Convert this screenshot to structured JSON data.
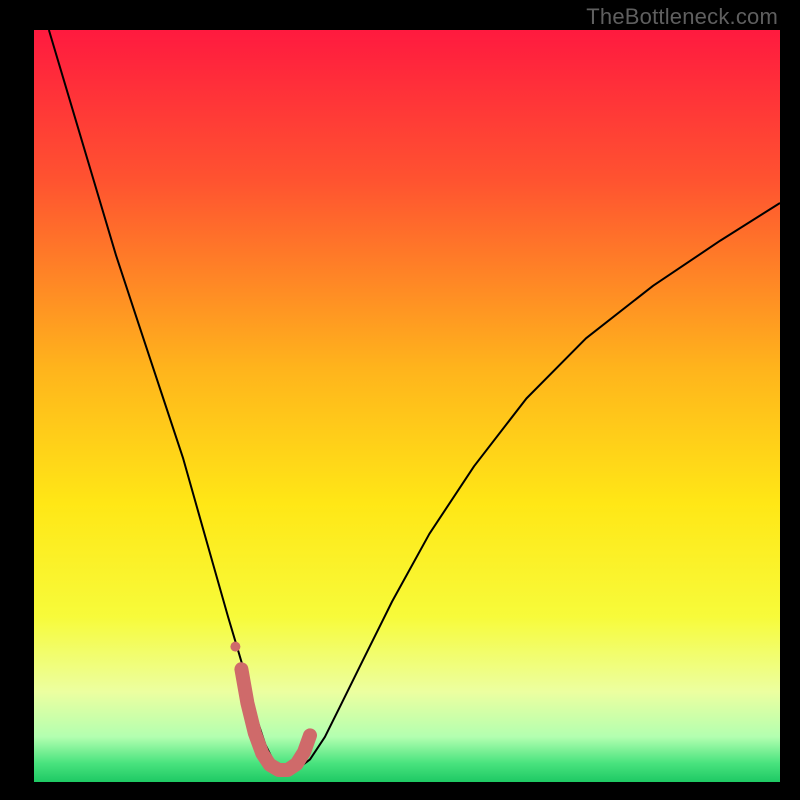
{
  "watermark": "TheBottleneck.com",
  "chart_data": {
    "type": "line",
    "title": "",
    "xlabel": "",
    "ylabel": "",
    "xlim": [
      0,
      100
    ],
    "ylim": [
      0,
      100
    ],
    "grid": false,
    "legend": false,
    "annotations": [],
    "background_gradient_stops": [
      {
        "offset": 0.0,
        "color": "#ff1a3f"
      },
      {
        "offset": 0.2,
        "color": "#ff5330"
      },
      {
        "offset": 0.45,
        "color": "#ffb41c"
      },
      {
        "offset": 0.63,
        "color": "#ffe716"
      },
      {
        "offset": 0.78,
        "color": "#f7fb3a"
      },
      {
        "offset": 0.88,
        "color": "#ecffa0"
      },
      {
        "offset": 0.94,
        "color": "#b3ffb0"
      },
      {
        "offset": 0.975,
        "color": "#49e37e"
      },
      {
        "offset": 1.0,
        "color": "#1ec964"
      }
    ],
    "series": [
      {
        "name": "bottleneck-curve",
        "stroke": "#000000",
        "stroke_width": 2,
        "x": [
          2,
          5,
          8,
          11,
          14,
          17,
          20,
          22,
          24,
          26,
          27.5,
          29,
          30,
          31,
          32,
          33.5,
          35,
          37,
          39,
          41,
          44,
          48,
          53,
          59,
          66,
          74,
          83,
          92,
          100
        ],
        "y": [
          100,
          90,
          80,
          70,
          61,
          52,
          43,
          36,
          29,
          22,
          17,
          12,
          8,
          5,
          3,
          1.5,
          1.5,
          3,
          6,
          10,
          16,
          24,
          33,
          42,
          51,
          59,
          66,
          72,
          77
        ]
      },
      {
        "name": "highlight-band",
        "stroke": "#cf6a6a",
        "stroke_width": 14,
        "linecap": "round",
        "x": [
          27.8,
          28.6,
          29.6,
          30.6,
          31.6,
          32.8,
          34.0,
          35.2,
          36.2,
          37.0
        ],
        "y": [
          15.0,
          10.5,
          6.5,
          3.8,
          2.3,
          1.6,
          1.6,
          2.4,
          4.0,
          6.2
        ]
      }
    ],
    "markers": [
      {
        "name": "highlight-dot",
        "x": 27.0,
        "y": 18.0,
        "r": 5,
        "fill": "#cf6a6a"
      }
    ]
  }
}
